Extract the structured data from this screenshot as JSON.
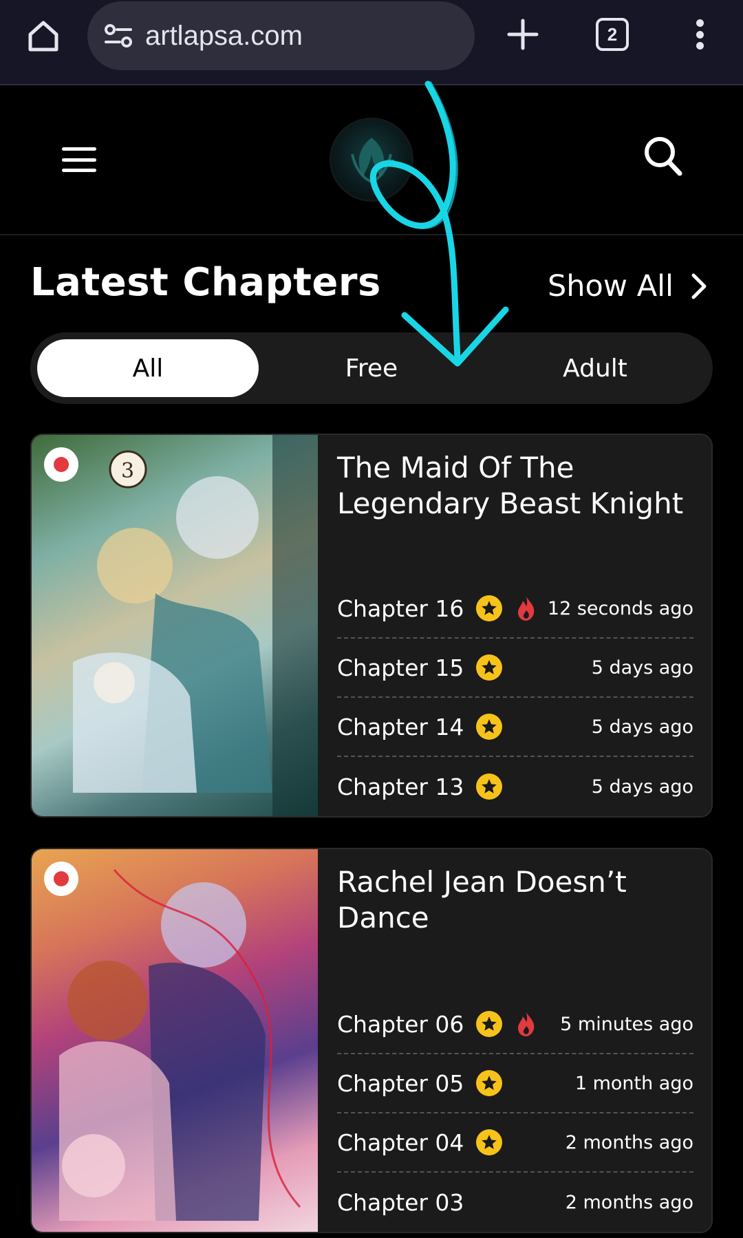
{
  "browser": {
    "url": "artlapsa.com",
    "tab_count": "2",
    "icons": [
      "home-icon",
      "site-settings-icon",
      "new-tab-plus-icon",
      "tab-switcher-icon",
      "more-vert-icon"
    ]
  },
  "header": {
    "icons": [
      "hamburger-menu-icon",
      "site-logo",
      "search-icon"
    ]
  },
  "section": {
    "title": "Latest Chapters",
    "show_all": "Show All"
  },
  "filters": {
    "tabs": [
      "All",
      "Free",
      "Adult"
    ],
    "active": "All"
  },
  "colors": {
    "background": "#000000",
    "card": "#1b1b1b",
    "star_badge": "#f7c31a",
    "fire_badge": "#e23a3f",
    "overlay_arrow": "#19d6e6",
    "browser_bar": "#171626"
  },
  "series": [
    {
      "title": "The Maid Of The Legendary Beast Knight",
      "chapters": [
        {
          "name": "Chapter 16",
          "star": true,
          "hot": true,
          "time": "12 seconds ago"
        },
        {
          "name": "Chapter 15",
          "star": true,
          "hot": false,
          "time": "5 days ago"
        },
        {
          "name": "Chapter 14",
          "star": true,
          "hot": false,
          "time": "5 days ago"
        },
        {
          "name": "Chapter 13",
          "star": true,
          "hot": false,
          "time": "5 days ago"
        }
      ]
    },
    {
      "title": "Rachel Jean Doesn’t Dance",
      "chapters": [
        {
          "name": "Chapter 06",
          "star": true,
          "hot": true,
          "time": "5 minutes ago"
        },
        {
          "name": "Chapter 05",
          "star": true,
          "hot": false,
          "time": "1 month ago"
        },
        {
          "name": "Chapter 04",
          "star": true,
          "hot": false,
          "time": "2 months ago"
        },
        {
          "name": "Chapter 03",
          "star": false,
          "hot": false,
          "time": "2 months ago"
        }
      ]
    }
  ]
}
